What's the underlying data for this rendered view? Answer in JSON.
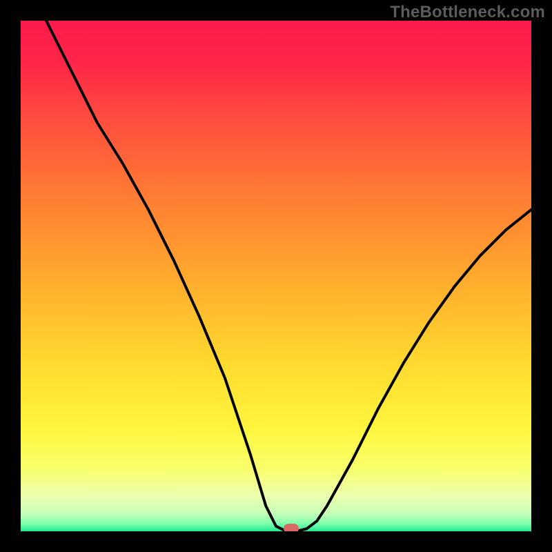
{
  "watermark": "TheBottleneck.com",
  "chart_data": {
    "type": "line",
    "title": "",
    "xlabel": "",
    "ylabel": "",
    "xlim": [
      0,
      100
    ],
    "ylim": [
      0,
      100
    ],
    "series": [
      {
        "name": "bottleneck-curve",
        "x": [
          5,
          10,
          15,
          20,
          25,
          30,
          35,
          40,
          45,
          48,
          50,
          52,
          54,
          56,
          58,
          60,
          65,
          70,
          75,
          80,
          85,
          90,
          95,
          100
        ],
        "values": [
          100,
          90,
          80,
          72,
          63,
          53,
          42,
          30,
          15,
          5,
          1,
          0,
          0,
          0.5,
          2,
          5,
          14,
          24,
          33,
          41,
          48,
          54,
          59,
          63
        ]
      }
    ],
    "marker": {
      "x": 53,
      "y": 0,
      "color": "#d86a63"
    },
    "gradient_stops": [
      {
        "offset": 0.0,
        "color": "#ff1a4b"
      },
      {
        "offset": 0.08,
        "color": "#ff2549"
      },
      {
        "offset": 0.18,
        "color": "#ff4840"
      },
      {
        "offset": 0.3,
        "color": "#ff6f36"
      },
      {
        "offset": 0.42,
        "color": "#ff9230"
      },
      {
        "offset": 0.55,
        "color": "#ffb82d"
      },
      {
        "offset": 0.68,
        "color": "#ffdc2f"
      },
      {
        "offset": 0.8,
        "color": "#fff63e"
      },
      {
        "offset": 0.88,
        "color": "#f8ff6e"
      },
      {
        "offset": 0.93,
        "color": "#ecffae"
      },
      {
        "offset": 0.965,
        "color": "#c7ffb9"
      },
      {
        "offset": 0.985,
        "color": "#7dffab"
      },
      {
        "offset": 1.0,
        "color": "#21e890"
      }
    ]
  }
}
